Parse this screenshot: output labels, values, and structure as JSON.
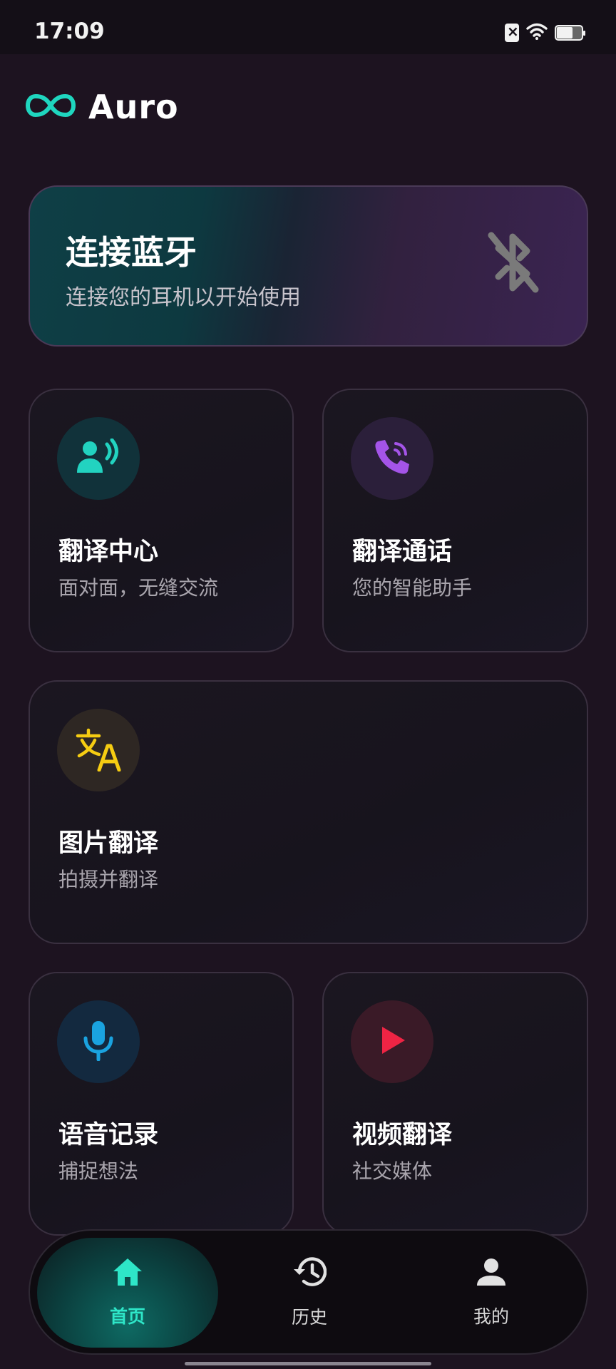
{
  "status_bar": {
    "time": "17:09",
    "icons": [
      "sim-off-icon",
      "wifi-icon",
      "battery-icon"
    ],
    "battery_level": 0.6
  },
  "header": {
    "logo_icon": "infinity-icon",
    "title": "Auro",
    "accent_color": "#1fd6bf"
  },
  "bluetooth_card": {
    "title": "连接蓝牙",
    "subtitle": "连接您的耳机以开始使用",
    "icon": "bluetooth-off-icon"
  },
  "features": [
    {
      "title": "翻译中心",
      "subtitle": "面对面，无缝交流",
      "icon": "speaking-person-icon",
      "color": "#22d3c0"
    },
    {
      "title": "翻译通话",
      "subtitle": "您的智能助手",
      "icon": "phone-call-icon",
      "color": "#a454e8"
    },
    {
      "title": "图片翻译",
      "subtitle": "拍摄并翻译",
      "icon": "translate-icon",
      "color": "#f5cc12"
    },
    {
      "title": "语音记录",
      "subtitle": "捕捉想法",
      "icon": "microphone-icon",
      "color": "#1aa3e0"
    },
    {
      "title": "视频翻译",
      "subtitle": "社交媒体",
      "icon": "play-icon",
      "color": "#ee2444"
    }
  ],
  "bottom_nav": {
    "items": [
      {
        "label": "首页",
        "icon": "home-icon",
        "active": true
      },
      {
        "label": "历史",
        "icon": "history-icon",
        "active": false
      },
      {
        "label": "我的",
        "icon": "profile-icon",
        "active": false
      }
    ]
  }
}
